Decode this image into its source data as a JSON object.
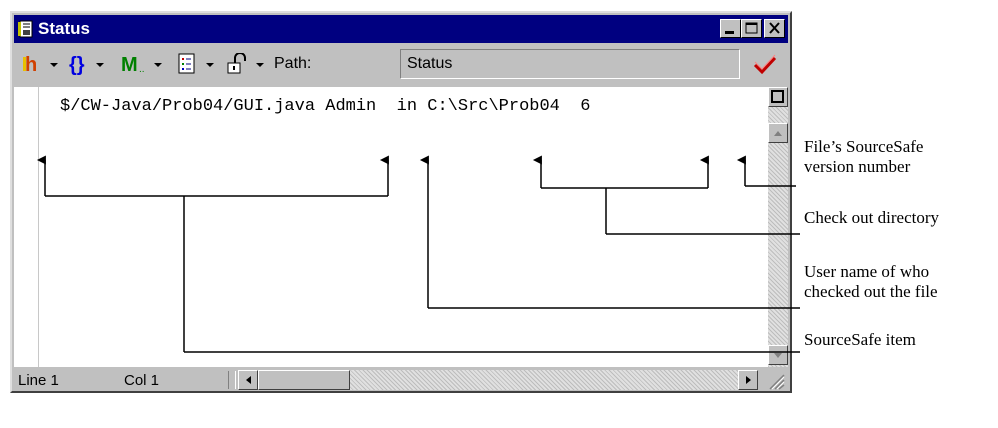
{
  "window": {
    "title": "Status",
    "icon": "status-window-icon"
  },
  "title_buttons": {
    "minimize": "minimize-icon",
    "maximize": "maximize-icon",
    "close": "close-icon"
  },
  "toolbar": {
    "icons": [
      "header-functions-icon",
      "braces-icon",
      "markers-icon",
      "document-list-icon",
      "lock-icon"
    ],
    "path_label": "Path:",
    "path_value": "Status",
    "checkmark_icon": "check-icon"
  },
  "editor": {
    "line_text": "$/CW-Java/Prob04/GUI.java Admin  in C:\\Src\\Prob04  6"
  },
  "statusbar": {
    "line": "Line 1",
    "col": "Col 1"
  },
  "callouts": {
    "version_line1": "File’s SourceSafe",
    "version_line2": "version number",
    "checkout_dir": "Check out directory",
    "user_line1": "User name of who",
    "user_line2": "checked out the file",
    "item": "SourceSafe item"
  }
}
